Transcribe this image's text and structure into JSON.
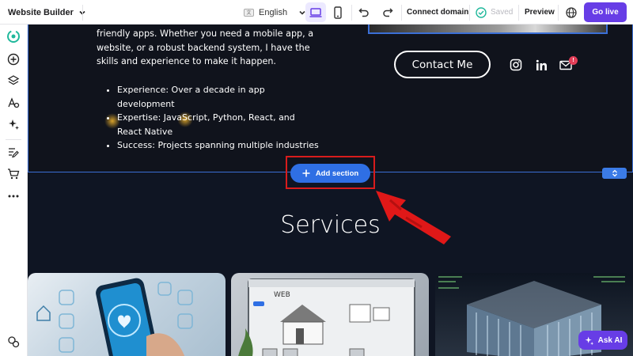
{
  "toolbar": {
    "site_menu_label": "Website Builder",
    "language": "English",
    "connect_domain": "Connect domain",
    "saved": "Saved",
    "preview": "Preview",
    "go_live": "Go live",
    "accent_color": "#673de6"
  },
  "sidebar": {
    "items": [
      {
        "icon": "ai-logo-icon"
      },
      {
        "icon": "add-element-icon"
      },
      {
        "icon": "layers-icon"
      },
      {
        "icon": "styles-icon"
      },
      {
        "icon": "ai-tools-icon"
      },
      {
        "icon": "pages-icon"
      },
      {
        "icon": "store-icon"
      },
      {
        "icon": "more-icon"
      },
      {
        "icon": "help-icon"
      }
    ]
  },
  "about": {
    "paragraph": "friendly apps. Whether you need a mobile app, a website, or a robust backend system, I have the skills and experience to make it happen.",
    "list": [
      "Experience: Over a decade in app development",
      "Expertise: JavaScript, Python, React, and React Native",
      "Success: Projects spanning multiple industries"
    ],
    "contact_button": "Contact Me",
    "mail_badge": "!"
  },
  "add_section_label": "Add section",
  "services": {
    "title": "Services",
    "card2_caption": "WEB"
  },
  "ask_ai_label": "Ask AI"
}
